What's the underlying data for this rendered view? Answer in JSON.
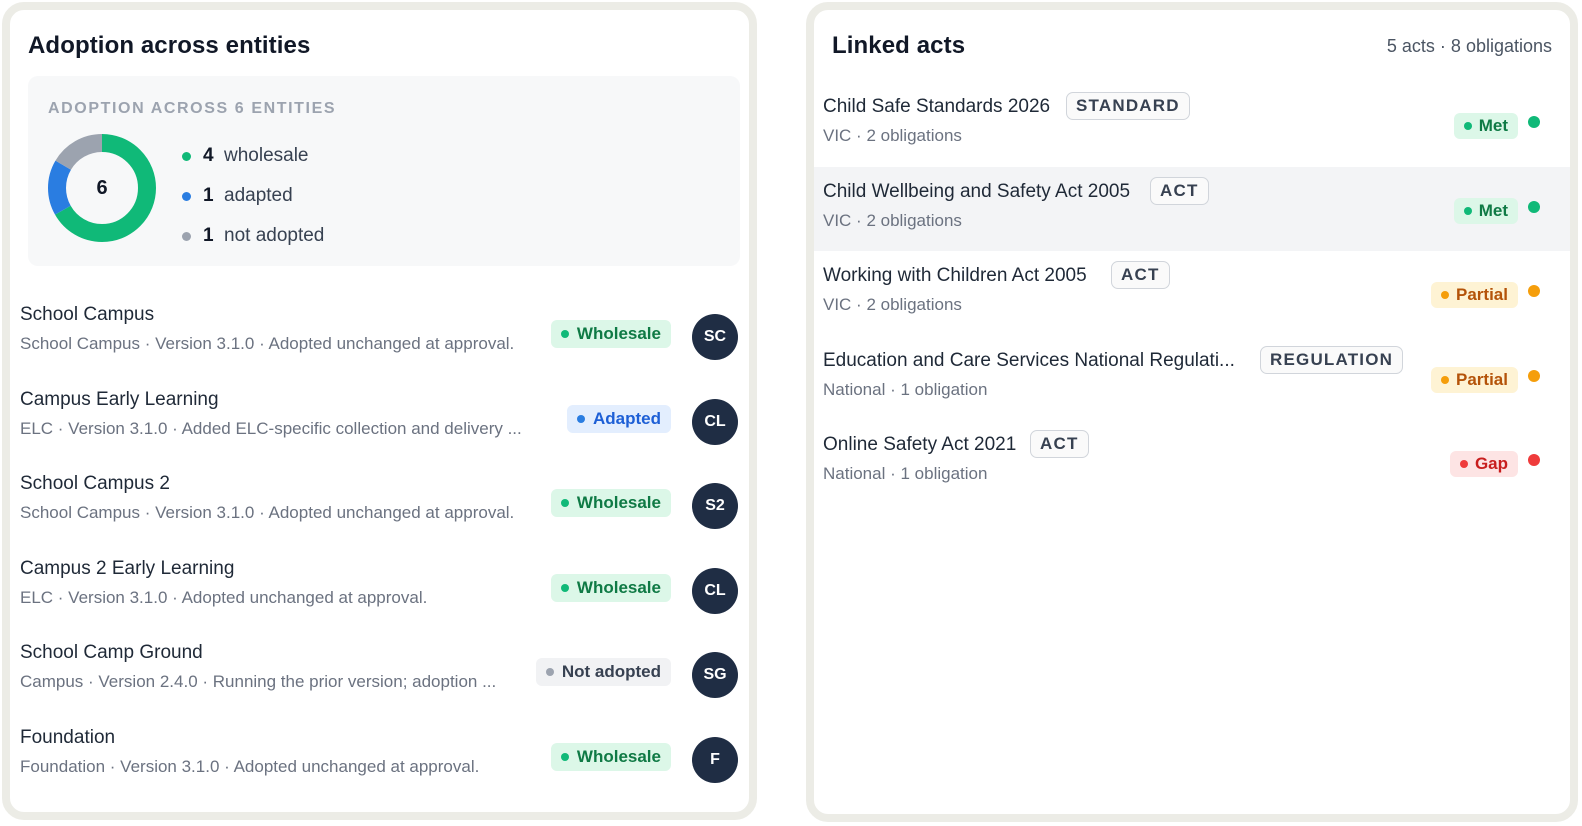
{
  "adoption": {
    "title": "Adoption across entities",
    "summary": {
      "heading": "ADOPTION ACROSS 6 ENTITIES",
      "total": "6",
      "breakdown": [
        {
          "count": "4",
          "label": "wholesale",
          "color": "#10b978",
          "value": 4
        },
        {
          "count": "1",
          "label": "adapted",
          "color": "#2a7de1",
          "value": 1
        },
        {
          "count": "1",
          "label": "not adopted",
          "color": "#9ca3af",
          "value": 1
        }
      ]
    },
    "entities": [
      {
        "name": "School Campus",
        "sub": "School Campus · Version 3.1.0 · Adopted unchanged at approval.",
        "badge": "Wholesale",
        "badge_kind": "green",
        "initials": "SC"
      },
      {
        "name": "Campus Early Learning",
        "sub": "ELC · Version 3.1.0 · Added ELC-specific collection and delivery ...",
        "badge": "Adapted",
        "badge_kind": "blue",
        "initials": "CL"
      },
      {
        "name": "School Campus 2",
        "sub": "School Campus · Version 3.1.0 · Adopted unchanged at approval.",
        "badge": "Wholesale",
        "badge_kind": "green",
        "initials": "S2"
      },
      {
        "name": "Campus 2 Early Learning",
        "sub": "ELC · Version 3.1.0 · Adopted unchanged at approval.",
        "badge": "Wholesale",
        "badge_kind": "green",
        "initials": "CL"
      },
      {
        "name": "School Camp Ground",
        "sub": "Campus · Version 2.4.0 · Running the prior version; adoption ...",
        "badge": "Not adopted",
        "badge_kind": "gray",
        "initials": "SG"
      },
      {
        "name": "Foundation",
        "sub": "Foundation · Version 3.1.0 · Adopted unchanged at approval.",
        "badge": "Wholesale",
        "badge_kind": "green",
        "initials": "F"
      }
    ]
  },
  "linked_acts": {
    "title": "Linked acts",
    "meta": "5 acts · 8 obligations",
    "acts": [
      {
        "name": "Child Safe Standards 2026",
        "type": "STANDARD",
        "sub": "VIC · 2 obligations",
        "status": "Met",
        "status_kind": "met",
        "indicator_color": "#10b978"
      },
      {
        "name": "Child Wellbeing and Safety Act 2005",
        "type": "ACT",
        "sub": "VIC · 2 obligations",
        "status": "Met",
        "status_kind": "met",
        "indicator_color": "#10b978"
      },
      {
        "name": "Working with Children Act 2005",
        "type": "ACT",
        "sub": "VIC · 2 obligations",
        "status": "Partial",
        "status_kind": "partial",
        "indicator_color": "#f59e0b"
      },
      {
        "name": "Education and Care Services National Regulati...",
        "type": "REGULATION",
        "sub": "National · 1 obligation",
        "status": "Partial",
        "status_kind": "partial",
        "indicator_color": "#f59e0b"
      },
      {
        "name": "Online Safety Act 2021",
        "type": "ACT",
        "sub": "National · 1 obligation",
        "status": "Gap",
        "status_kind": "gap",
        "indicator_color": "#ef3b3b"
      }
    ]
  }
}
